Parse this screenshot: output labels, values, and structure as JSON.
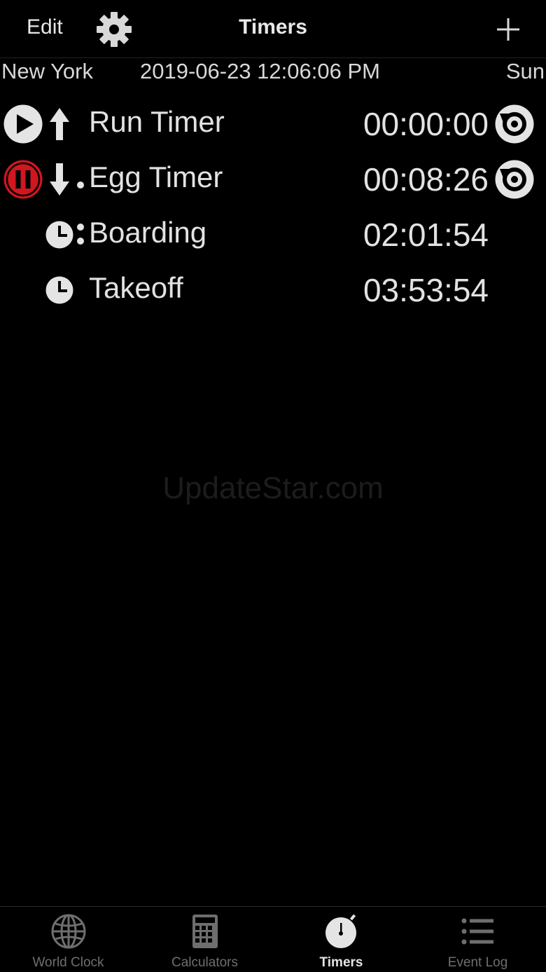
{
  "colors": {
    "background": "#000000",
    "text": "#e2e2e2",
    "pause_accent": "#d0161f",
    "inactive_tab": "#6e6e6e"
  },
  "nav": {
    "edit_label": "Edit",
    "title": "Timers",
    "settings_icon": "gear-icon",
    "add_icon": "plus-icon"
  },
  "info": {
    "city": "New York",
    "datetime": "2019-06-23 12:06:06 PM",
    "day": "Sun"
  },
  "timers": [
    {
      "label": "Run Timer",
      "time": "00:00:00",
      "control": "play",
      "direction": "up",
      "has_reset": true
    },
    {
      "label": "Egg Timer",
      "time": "00:08:26",
      "control": "pause",
      "direction": "down",
      "has_reset": true
    },
    {
      "label": "Boarding",
      "time": "02:01:54",
      "control": "none",
      "direction": "clock",
      "has_reset": false
    },
    {
      "label": "Takeoff",
      "time": "03:53:54",
      "control": "none",
      "direction": "clock",
      "has_reset": false
    }
  ],
  "watermark": "UpdateStar.com",
  "tabs": [
    {
      "label": "World Clock",
      "icon": "globe-icon",
      "active": false
    },
    {
      "label": "Calculators",
      "icon": "calculator-icon",
      "active": false
    },
    {
      "label": "Timers",
      "icon": "stopwatch-icon",
      "active": true
    },
    {
      "label": "Event Log",
      "icon": "list-icon",
      "active": false
    }
  ]
}
